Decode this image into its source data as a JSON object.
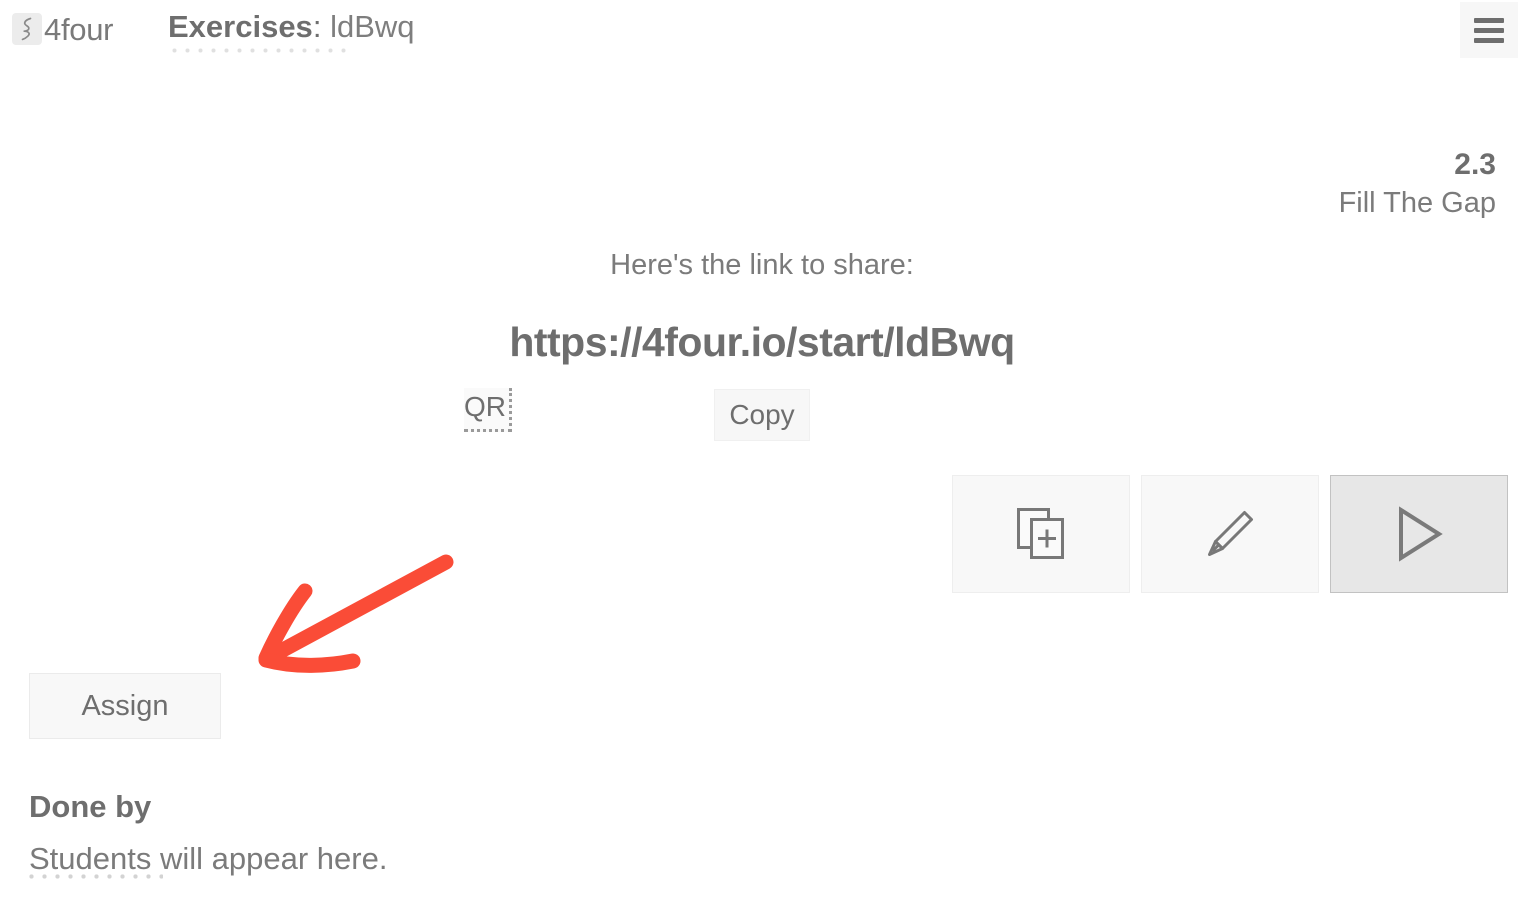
{
  "header": {
    "logo_icon": "squiggle-logo-icon",
    "brand_name": "4four",
    "breadcrumb_section": "Exercises",
    "breadcrumb_separator": ":",
    "breadcrumb_code": "ldBwq",
    "menu_icon": "hamburger-menu-icon"
  },
  "exercise": {
    "number": "2.3",
    "type": "Fill The Gap"
  },
  "share": {
    "caption": "Here's the link to share:",
    "url": "https://4four.io/start/ldBwq",
    "qr_label": "QR",
    "copy_label": "Copy"
  },
  "tools": [
    {
      "name": "duplicate-exercise-button",
      "icon": "duplicate-plus-icon",
      "active": false
    },
    {
      "name": "edit-exercise-button",
      "icon": "pencil-icon",
      "active": false
    },
    {
      "name": "play-exercise-button",
      "icon": "play-triangle-icon",
      "active": true
    }
  ],
  "assign": {
    "label": "Assign"
  },
  "done_by": {
    "title": "Done by",
    "empty_text": "Students will appear here."
  },
  "annotation": {
    "type": "hand-drawn-arrow",
    "direction": "down-left",
    "points_to": "assign-button",
    "color": "#fa4c37"
  },
  "colors": {
    "text": "#6e6e6e",
    "muted_text": "#7b7b7b",
    "panel": "#f8f8f8",
    "panel_active": "#e7e7e7",
    "border": "#eeeeee",
    "border_active": "#c2c2c2",
    "accent_annotation": "#fa4c37",
    "background": "#ffffff"
  }
}
